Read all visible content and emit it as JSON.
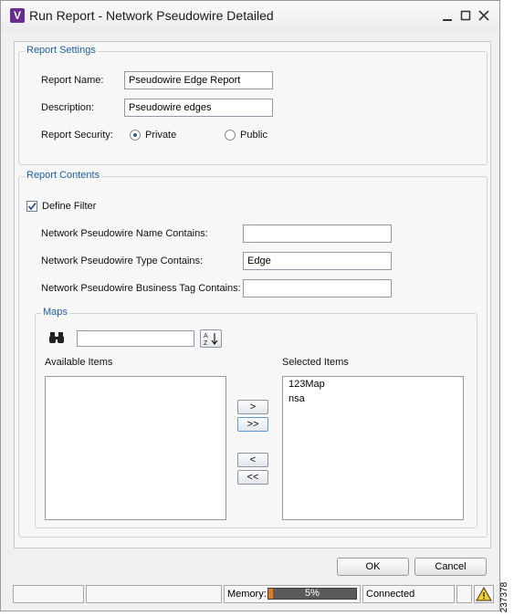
{
  "window": {
    "icon_letter": "V",
    "title": "Run Report - Network Pseudowire Detailed",
    "min_label": "minimize",
    "max_label": "maximize",
    "close_label": "close"
  },
  "report_settings": {
    "group_label": "Report Settings",
    "name_label": "Report Name:",
    "name_value": "Pseudowire Edge Report",
    "description_label": "Description:",
    "description_value": "Pseudowire edges",
    "security_label": "Report Security:",
    "private_label": "Private",
    "public_label": "Public",
    "selected_security": "Private"
  },
  "report_contents": {
    "group_label": "Report Contents",
    "define_filter_label": "Define Filter",
    "define_filter_checked": true,
    "name_contains_label": "Network Pseudowire Name Contains:",
    "name_contains_value": "",
    "type_contains_label": "Network Pseudowire Type Contains:",
    "type_contains_value": "Edge",
    "tag_contains_label": "Network Pseudowire Business Tag Contains:",
    "tag_contains_value": ""
  },
  "maps": {
    "group_label": "Maps",
    "search_value": "",
    "available_label": "Available Items",
    "selected_label": "Selected Items",
    "available_items": [],
    "selected_items": [
      "123Map",
      "nsa"
    ],
    "move_right": ">",
    "move_all_right": ">>",
    "move_left": "<",
    "move_all_left": "<<"
  },
  "actions": {
    "ok": "OK",
    "cancel": "Cancel"
  },
  "statusbar": {
    "memory_label": "Memory:",
    "memory_percent": "5%",
    "memory_fraction": 0.05,
    "connection": "Connected"
  },
  "figure_code": "237378",
  "colors": {
    "group_title": "#1f5fa8",
    "memory_fill": "#e07a1e",
    "app_icon": "#6b2a8f"
  }
}
